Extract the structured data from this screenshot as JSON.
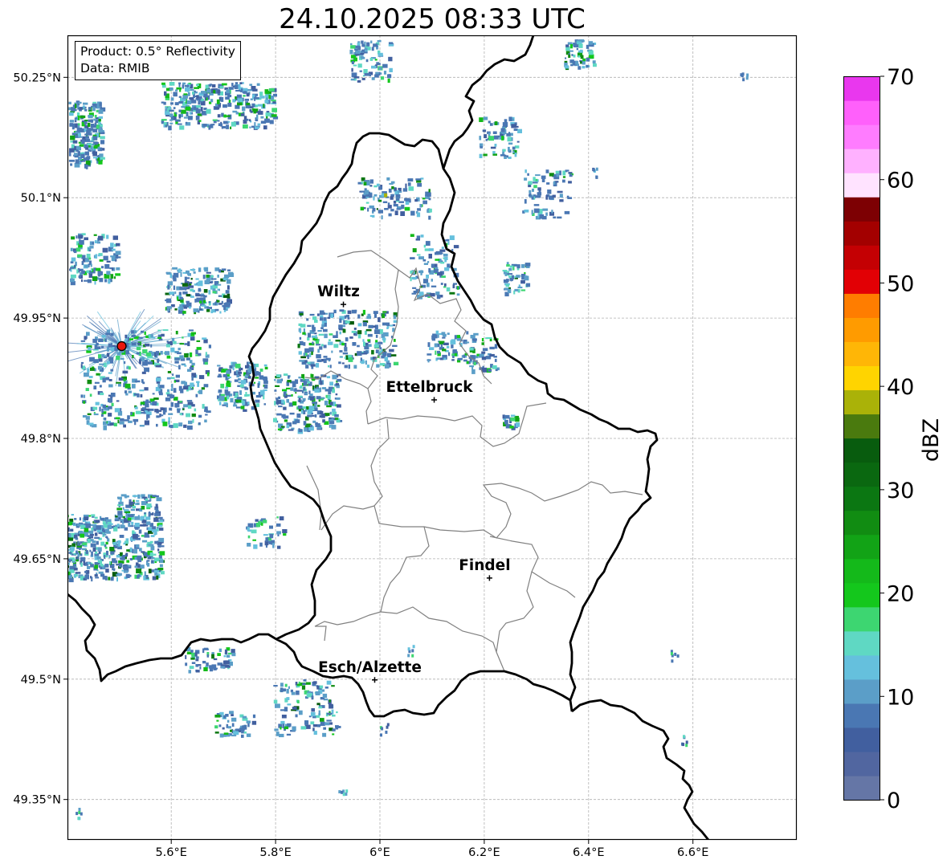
{
  "title": "24.10.2025 08:33 UTC",
  "infobox": {
    "product": "Product: 0.5° Reflectivity",
    "data": "Data: RMIB"
  },
  "map": {
    "lon_range": [
      5.4,
      6.8
    ],
    "lat_range": [
      49.3,
      50.3
    ],
    "lon_ticks": [
      {
        "value": 5.6,
        "label": "5.6°E"
      },
      {
        "value": 5.8,
        "label": "5.8°E"
      },
      {
        "value": 6.0,
        "label": "6°E"
      },
      {
        "value": 6.2,
        "label": "6.2°E"
      },
      {
        "value": 6.4,
        "label": "6.4°E"
      },
      {
        "value": 6.6,
        "label": "6.6°E"
      }
    ],
    "lat_ticks": [
      {
        "value": 50.25,
        "label": "50.25°N"
      },
      {
        "value": 50.1,
        "label": "50.1°N"
      },
      {
        "value": 49.95,
        "label": "49.95°N"
      },
      {
        "value": 49.8,
        "label": "49.8°N"
      },
      {
        "value": 49.65,
        "label": "49.65°N"
      },
      {
        "value": 49.5,
        "label": "49.5°N"
      },
      {
        "value": 49.35,
        "label": "49.35°N"
      }
    ],
    "cities": [
      {
        "name": "Wiltz",
        "lon": 5.93,
        "lat": 49.967
      },
      {
        "name": "Ettelbruck",
        "lon": 6.104,
        "lat": 49.848
      },
      {
        "name": "Findel",
        "lon": 6.21,
        "lat": 49.626
      },
      {
        "name": "Esch/Alzette",
        "lon": 5.99,
        "lat": 49.499
      }
    ],
    "radar_site": {
      "lon": 5.505,
      "lat": 49.915
    },
    "colors": {
      "border": "#000000",
      "admin": "#808080",
      "grid": "#b0b0b0",
      "radar_site": "#e8170e"
    }
  },
  "colorbar": {
    "label": "dBZ",
    "vmin": 0,
    "vmax": 70,
    "step": 2.5,
    "ticks": [
      0,
      10,
      20,
      30,
      40,
      50,
      60,
      70
    ],
    "colors": [
      "#6576a6",
      "#5166a0",
      "#415f9f",
      "#4a77b3",
      "#5b9ec8",
      "#65c0dd",
      "#5fd8c3",
      "#3dd671",
      "#14c71c",
      "#14b91a",
      "#12a316",
      "#118c12",
      "#0b7712",
      "#0a6810",
      "#085c0e",
      "#4a7a0e",
      "#aab208",
      "#ffd400",
      "#ffb606",
      "#ff9b00",
      "#ff7d00",
      "#e20005",
      "#c40003",
      "#a30000",
      "#7d0003",
      "#ffe3ff",
      "#ffb1ff",
      "#ff7cff",
      "#ff60fb",
      "#e937ee"
    ]
  }
}
